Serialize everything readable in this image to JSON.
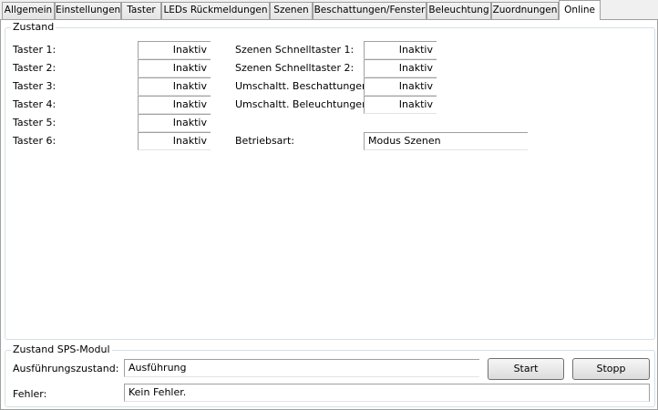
{
  "tabs": [
    {
      "label": "Allgemein"
    },
    {
      "label": "Einstellungen"
    },
    {
      "label": "Taster"
    },
    {
      "label": "LEDs Rückmeldungen"
    },
    {
      "label": "Szenen"
    },
    {
      "label": "Beschattungen/Fenster"
    },
    {
      "label": "Beleuchtung"
    },
    {
      "label": "Zuordnungen"
    },
    {
      "label": "Online",
      "active": true
    }
  ],
  "zustand": {
    "title": "Zustand",
    "left_rows": [
      {
        "label": "Taster 1:",
        "value": "Inaktiv"
      },
      {
        "label": "Taster 2:",
        "value": "Inaktiv"
      },
      {
        "label": "Taster 3:",
        "value": "Inaktiv"
      },
      {
        "label": "Taster 4:",
        "value": "Inaktiv"
      },
      {
        "label": "Taster 5:",
        "value": "Inaktiv"
      },
      {
        "label": "Taster 6:",
        "value": "Inaktiv"
      }
    ],
    "right_rows": [
      {
        "label": "Szenen Schnelltaster 1:",
        "value": "Inaktiv"
      },
      {
        "label": "Szenen Schnelltaster 2:",
        "value": "Inaktiv"
      },
      {
        "label": "Umschaltt. Beschattungen:",
        "value": "Inaktiv"
      },
      {
        "label": "Umschaltt. Beleuchtungen:",
        "value": "Inaktiv"
      }
    ],
    "betriebsart": {
      "label": "Betriebsart:",
      "value": "Modus Szenen"
    }
  },
  "sps": {
    "title": "Zustand SPS-Modul",
    "ausfuehrung": {
      "label": "Ausführungszustand:",
      "value": "Ausführung"
    },
    "fehler": {
      "label": "Fehler:",
      "value": "Kein Fehler."
    },
    "start_label": "Start",
    "stopp_label": "Stopp"
  }
}
